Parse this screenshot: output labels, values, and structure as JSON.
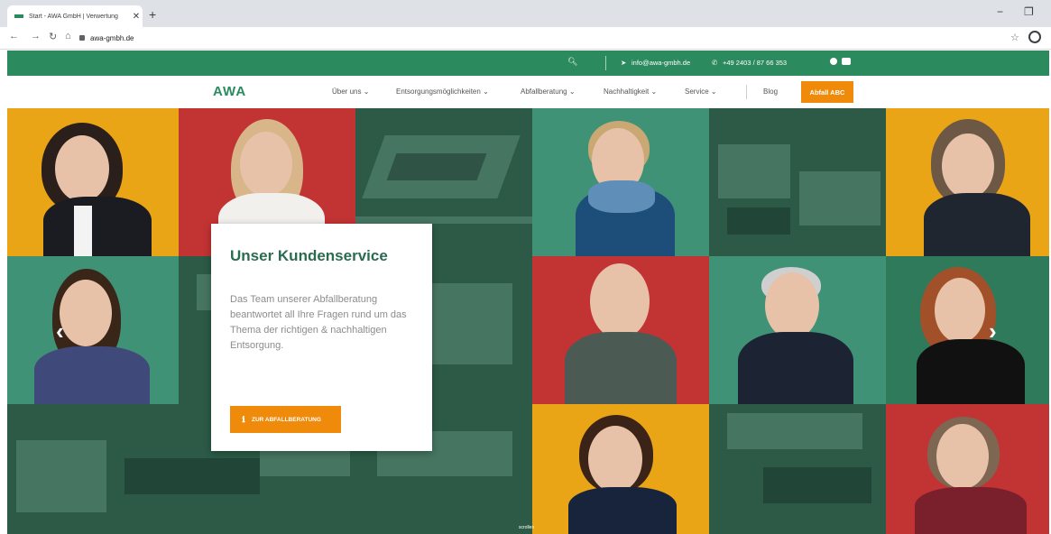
{
  "browser": {
    "tab_title": "Start - AWA GmbH | Verwertung",
    "tab_close": "✕",
    "new_tab": "+",
    "url": "awa-gmbh.de",
    "win_min": "−",
    "win_restore": "❐"
  },
  "topbar": {
    "email": "info@awa-gmbh.de",
    "phone": "+49 2403 / 87 66 353"
  },
  "nav": {
    "logo": "AWA",
    "items": [
      "Über uns",
      "Entsorgungsmöglichkeiten",
      "Abfallberatung",
      "Nachhaltigkeit",
      "Service"
    ],
    "blog": "Blog",
    "abc_button": "Abfall ABC"
  },
  "hero": {
    "heading": "Unser Kundenservice",
    "text": "Das Team unserer Abfallberatung beantwortet all Ihre Fragen rund um das Thema der richtigen & nachhaltigen Entsorgung.",
    "cta": "ZUR ABFALLBERATUNG",
    "scroll": "scrollen"
  },
  "colors": {
    "brand_green": "#2c8a5f",
    "accent_orange": "#ef8a0a",
    "red": "#c23333",
    "yellow": "#e9a515"
  }
}
